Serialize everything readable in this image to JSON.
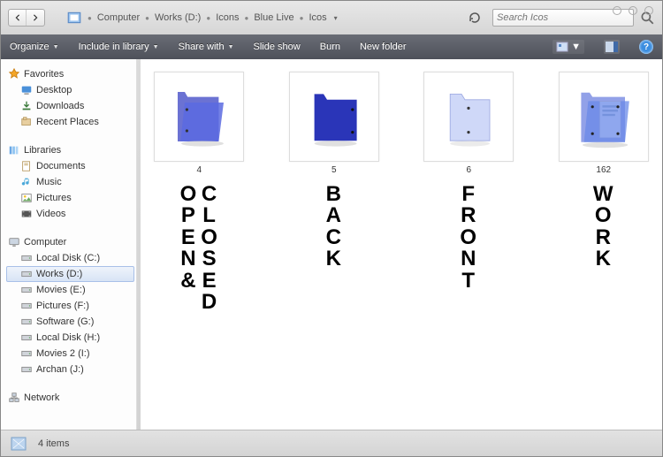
{
  "breadcrumb": [
    "Computer",
    "Works (D:)",
    "Icons",
    "Blue Live",
    "Icos"
  ],
  "search": {
    "placeholder": "Search Icos"
  },
  "commands": {
    "organize": "Organize",
    "include": "Include in library",
    "share": "Share with",
    "slideshow": "Slide show",
    "burn": "Burn",
    "newfolder": "New folder",
    "help": "?"
  },
  "sidebar": {
    "favorites": {
      "label": "Favorites",
      "items": [
        {
          "label": "Desktop"
        },
        {
          "label": "Downloads"
        },
        {
          "label": "Recent Places"
        }
      ]
    },
    "libraries": {
      "label": "Libraries",
      "items": [
        {
          "label": "Documents"
        },
        {
          "label": "Music"
        },
        {
          "label": "Pictures"
        },
        {
          "label": "Videos"
        }
      ]
    },
    "computer": {
      "label": "Computer",
      "items": [
        {
          "label": "Local Disk (C:)"
        },
        {
          "label": "Works (D:)",
          "selected": true
        },
        {
          "label": "Movies (E:)"
        },
        {
          "label": "Pictures (F:)"
        },
        {
          "label": "Software (G:)"
        },
        {
          "label": "Local Disk (H:)"
        },
        {
          "label": "Movies 2 (I:)"
        },
        {
          "label": "Archan (J:)"
        }
      ]
    },
    "network": {
      "label": "Network"
    }
  },
  "files": [
    {
      "name": "4",
      "annotation": [
        "OPEN&",
        "CLOSED"
      ],
      "icon": "folder-open-blue"
    },
    {
      "name": "5",
      "annotation": [
        "BACK"
      ],
      "icon": "folder-back-blue"
    },
    {
      "name": "6",
      "annotation": [
        "FRONT"
      ],
      "icon": "folder-front-blue"
    },
    {
      "name": "162",
      "annotation": [
        "WORK"
      ],
      "icon": "folder-work-blue"
    }
  ],
  "status": {
    "text": "4 items"
  }
}
